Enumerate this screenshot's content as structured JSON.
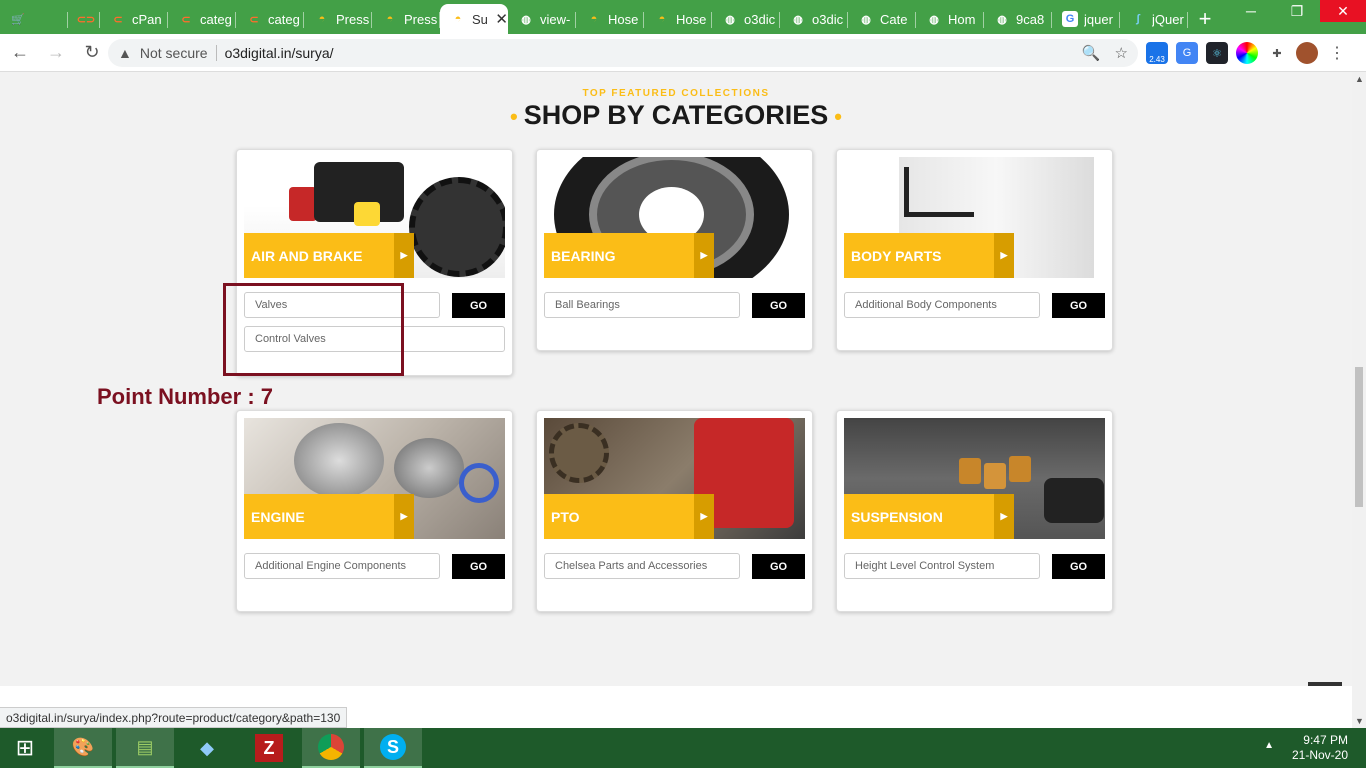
{
  "browser": {
    "tabs": [
      {
        "title": "",
        "icon": "cart-icon"
      },
      {
        "title": "",
        "icon": "cpanel-icon"
      },
      {
        "title": "cPan",
        "icon": "cpanel-icon"
      },
      {
        "title": "categ",
        "icon": "cpanel-icon"
      },
      {
        "title": "categ",
        "icon": "cpanel-icon"
      },
      {
        "title": "Press",
        "icon": "gauge-icon"
      },
      {
        "title": "Press",
        "icon": "gauge-icon"
      },
      {
        "title": "Su",
        "icon": "gauge-icon",
        "active": true
      },
      {
        "title": "view-",
        "icon": "globe-icon"
      },
      {
        "title": "Hose",
        "icon": "gauge-icon"
      },
      {
        "title": "Hose",
        "icon": "gauge-icon"
      },
      {
        "title": "o3dic",
        "icon": "globe-icon"
      },
      {
        "title": "o3dic",
        "icon": "globe-icon"
      },
      {
        "title": "Cate",
        "icon": "globe-icon"
      },
      {
        "title": "Hom",
        "icon": "globe-icon"
      },
      {
        "title": "9ca8",
        "icon": "globe-icon"
      },
      {
        "title": "jquer",
        "icon": "google-icon"
      },
      {
        "title": "jQuer",
        "icon": "jquery-icon"
      }
    ],
    "new_tab": "+",
    "address": {
      "security": "Not secure",
      "url": "o3digital.in/surya/"
    },
    "extension_badge": "2.43"
  },
  "page": {
    "subtitle": "TOP FEATURED COLLECTIONS",
    "heading": "SHOP BY CATEGORIES",
    "categories": [
      {
        "name": "AIR AND BRAKE",
        "select": "Valves",
        "select2": "Control Valves",
        "go": "GO"
      },
      {
        "name": "BEARING",
        "select": "Ball Bearings",
        "go": "GO"
      },
      {
        "name": "BODY PARTS",
        "select": "Additional Body Components",
        "go": "GO"
      },
      {
        "name": "ENGINE",
        "select": "Additional Engine Components",
        "go": "GO"
      },
      {
        "name": "PTO",
        "select": "Chelsea Parts and Accessories",
        "go": "GO"
      },
      {
        "name": "SUSPENSION",
        "select": "Height Level Control System",
        "go": "GO"
      }
    ],
    "annotation": "Point Number : 7"
  },
  "status_bar": "o3digital.in/surya/index.php?route=product/category&path=130",
  "taskbar": {
    "time": "9:47 PM",
    "date": "21-Nov-20"
  },
  "colors": {
    "accent": "#fbbd17",
    "annotation": "#7b1020",
    "tabbar": "#43a047"
  }
}
